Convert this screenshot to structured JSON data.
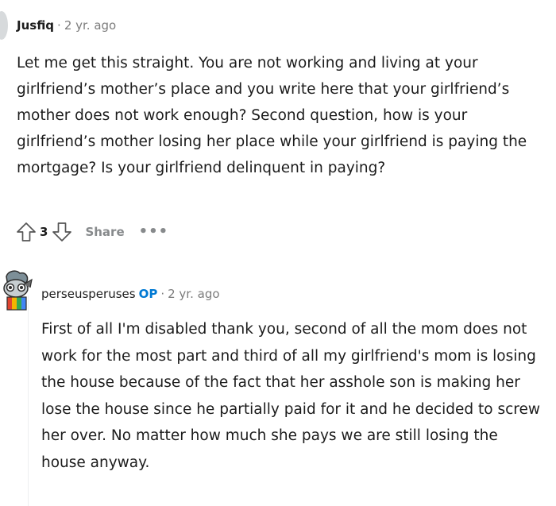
{
  "comments": [
    {
      "author": "Jusfiq",
      "separator": "·",
      "time": "2 yr. ago",
      "body": "Let me get this straight. You are not working and living at your girlfriend’s mother’s place and you write here that your girlfriend’s mother does not work enough? Second question, how is your girlfriend’s mother losing her place while your girlfriend is paying the mortgage? Is your girlfriend delinquent in paying?",
      "actions": {
        "upvote_icon": "arrow-up-icon",
        "score": "3",
        "downvote_icon": "arrow-down-icon",
        "share_label": "Share",
        "more_label": "•••"
      }
    },
    {
      "author": "perseusperuses",
      "op_badge": "OP",
      "separator": "·",
      "time": "2 yr. ago",
      "body": "First of all I'm disabled thank you, second of all the mom does not work for the most part and third of all my girlfriend's mom is losing the house because of the fact that her asshole son is making her lose the house since he partially paid for it and he decided to screw her over. No matter how much she pays we are still losing the house anyway."
    }
  ],
  "colors": {
    "text": "#1c1c1c",
    "meta": "#7c7c7c",
    "op_badge": "#0079d3",
    "action_grey": "#878a8c",
    "thread_line": "#edeff1"
  }
}
